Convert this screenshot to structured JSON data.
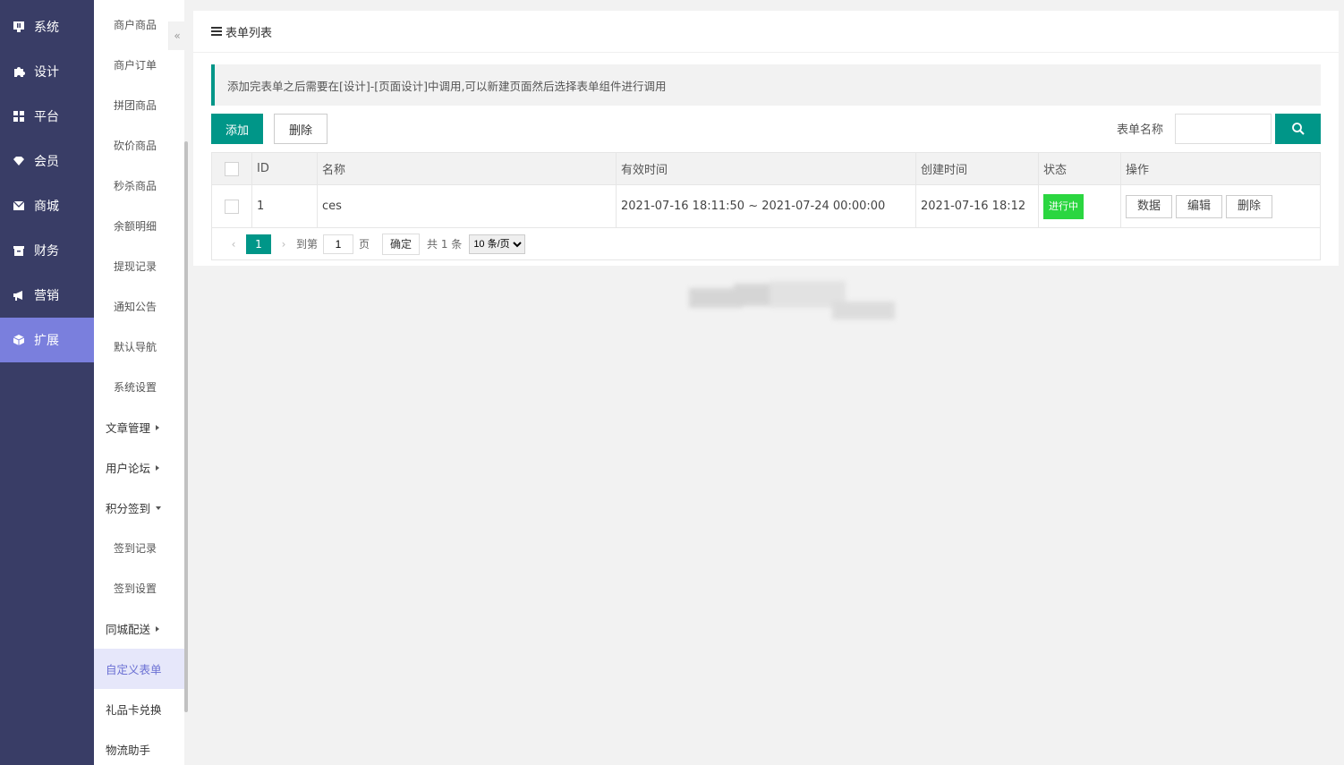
{
  "nav1": {
    "items": [
      {
        "label": "系统",
        "icon": "monitor-icon"
      },
      {
        "label": "设计",
        "icon": "puzzle-icon"
      },
      {
        "label": "平台",
        "icon": "grid-icon"
      },
      {
        "label": "会员",
        "icon": "gem-icon"
      },
      {
        "label": "商城",
        "icon": "envelope-icon"
      },
      {
        "label": "财务",
        "icon": "wallet-icon"
      },
      {
        "label": "营销",
        "icon": "megaphone-icon"
      },
      {
        "label": "扩展",
        "icon": "cube-icon"
      }
    ],
    "active_color": "#7a7fdd",
    "bg_color": "#393d66"
  },
  "nav2": {
    "items": [
      {
        "label": "商户商品",
        "kind": "sub"
      },
      {
        "label": "商户订单",
        "kind": "sub"
      },
      {
        "label": "拼团商品",
        "kind": "sub"
      },
      {
        "label": "砍价商品",
        "kind": "sub"
      },
      {
        "label": "秒杀商品",
        "kind": "sub"
      },
      {
        "label": "余额明细",
        "kind": "sub"
      },
      {
        "label": "提现记录",
        "kind": "sub"
      },
      {
        "label": "通知公告",
        "kind": "sub"
      },
      {
        "label": "默认导航",
        "kind": "sub"
      },
      {
        "label": "系统设置",
        "kind": "sub"
      },
      {
        "label": "文章管理",
        "kind": "group-collapsed"
      },
      {
        "label": "用户论坛",
        "kind": "group-collapsed"
      },
      {
        "label": "积分签到",
        "kind": "group-expanded"
      },
      {
        "label": "签到记录",
        "kind": "sub"
      },
      {
        "label": "签到设置",
        "kind": "sub"
      },
      {
        "label": "同城配送",
        "kind": "group-collapsed"
      },
      {
        "label": "自定义表单",
        "kind": "group-active"
      },
      {
        "label": "礼品卡兑换",
        "kind": "group"
      },
      {
        "label": "物流助手",
        "kind": "group"
      }
    ],
    "collapse_glyph": "«"
  },
  "card": {
    "title": "表单列表",
    "notice": "添加完表单之后需要在[设计]-[页面设计]中调用,可以新建页面然后选择表单组件进行调用",
    "add_label": "添加",
    "delete_label": "删除",
    "search_label": "表单名称",
    "search_value": ""
  },
  "table": {
    "headers": [
      "ID",
      "名称",
      "有效时间",
      "创建时间",
      "状态",
      "操作"
    ],
    "rows": [
      {
        "id": "1",
        "name": "ces",
        "valid_time": "2021-07-16 18:11:50 ~ 2021-07-24 00:00:00",
        "created": "2021-07-16 18:12",
        "status": "进行中",
        "ops": [
          "数据",
          "编辑",
          "删除"
        ]
      }
    ]
  },
  "pager": {
    "current": "1",
    "goto_label": "到第",
    "goto_value": "1",
    "page_unit": "页",
    "confirm_label": "确定",
    "total_label": "共 1 条",
    "page_size": "10 条/页"
  },
  "colors": {
    "primary": "#009688",
    "status_green": "#2bd640"
  }
}
